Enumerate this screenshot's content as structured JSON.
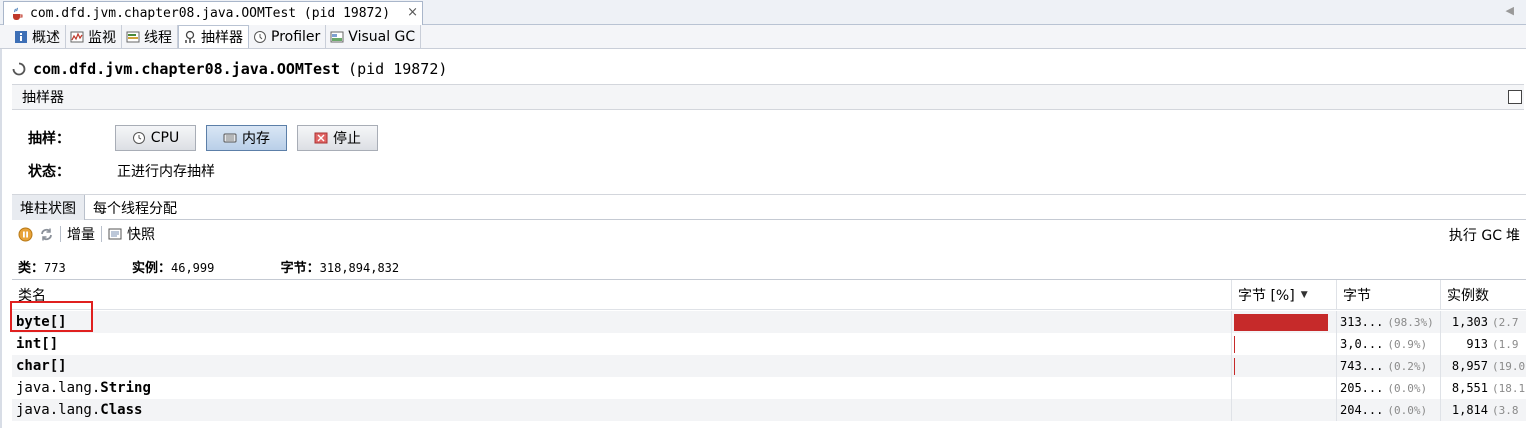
{
  "window": {
    "doc_tab_title": "com.dfd.jvm.chapter08.java.OOMTest (pid 19872)",
    "close_glyph": "×"
  },
  "sub_tabs": [
    {
      "label": "概述",
      "icon": "info-icon"
    },
    {
      "label": "监视",
      "icon": "monitor-icon"
    },
    {
      "label": "线程",
      "icon": "threads-icon"
    },
    {
      "label": "抽样器",
      "icon": "sampler-icon"
    },
    {
      "label": "Profiler",
      "icon": "profiler-icon"
    },
    {
      "label": "Visual GC",
      "icon": "visualgc-icon"
    }
  ],
  "header": {
    "title": "com.dfd.jvm.chapter08.java.OOMTest",
    "pid": "(pid 19872)"
  },
  "section": {
    "title": "抽样器"
  },
  "sampling": {
    "label": "抽样：",
    "cpu_button": "CPU",
    "memory_button": "内存",
    "stop_button": "停止",
    "status_label": "状态：",
    "status_value": "正进行内存抽样"
  },
  "view_tabs": [
    "堆柱状图",
    "每个线程分配"
  ],
  "toolbar": {
    "delta_label": "增量",
    "snapshot_label": "快照",
    "gc_label": "执行 GC",
    "heap_label": "堆"
  },
  "summary": {
    "classes_label": "类：",
    "classes_value": "773",
    "instances_label": "实例：",
    "instances_value": "46,999",
    "bytes_label": "字节：",
    "bytes_value": "318,894,832"
  },
  "table": {
    "columns": {
      "name": "类名",
      "bytes_pct": "字节 [%]",
      "bytes": "字节",
      "instances": "实例数"
    },
    "rows": [
      {
        "pkg": "",
        "cls": "byte[]",
        "bar_fraction": 0.983,
        "bytes": "313...",
        "bytes_pct": "(98.3%)",
        "instances": "1,303",
        "inst_pct": "(2.7"
      },
      {
        "pkg": "",
        "cls": "int[]",
        "bar_fraction": 0.009,
        "bytes": "3,0...",
        "bytes_pct": "(0.9%)",
        "instances": "913",
        "inst_pct": "(1.9"
      },
      {
        "pkg": "",
        "cls": "char[]",
        "bar_fraction": 0.002,
        "bytes": "743...",
        "bytes_pct": "(0.2%)",
        "instances": "8,957",
        "inst_pct": "(19.0"
      },
      {
        "pkg": "java.lang.",
        "cls": "String",
        "bar_fraction": 0.0,
        "bytes": "205...",
        "bytes_pct": "(0.0%)",
        "instances": "8,551",
        "inst_pct": "(18.1"
      },
      {
        "pkg": "java.lang.",
        "cls": "Class",
        "bar_fraction": 0.0,
        "bytes": "204...",
        "bytes_pct": "(0.0%)",
        "instances": "1,814",
        "inst_pct": "(3.8"
      }
    ]
  },
  "colors": {
    "bar": "#c62a2a",
    "highlight_box": "#e0201f"
  }
}
